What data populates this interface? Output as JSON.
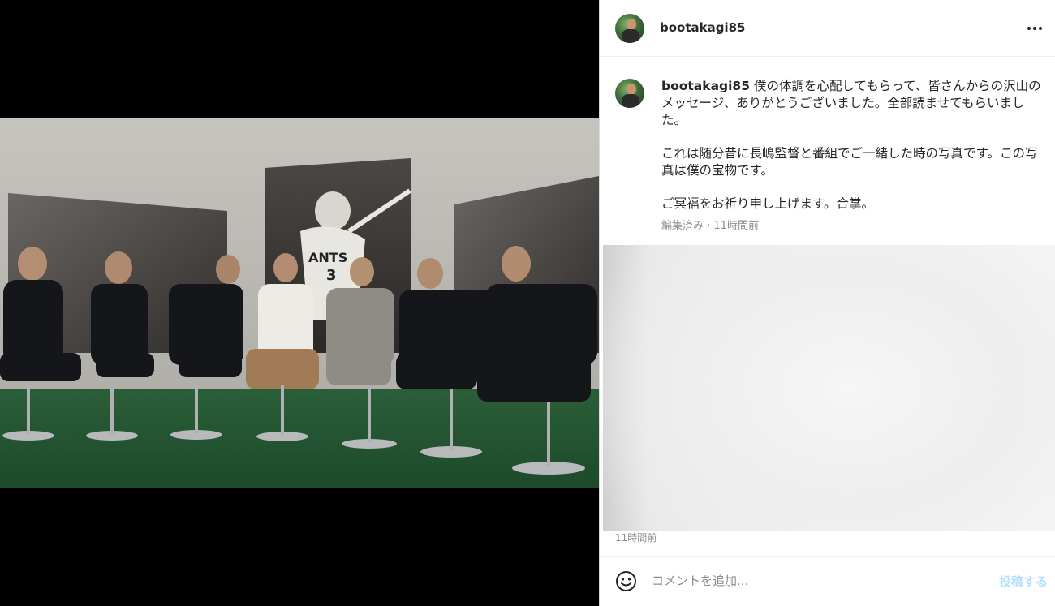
{
  "post": {
    "username": "bootakagi85",
    "caption_paragraph_1": "僕の体調を心配してもらって、皆さんからの沢山のメッセージ、ありがとうございました。全部読ませてもらいました。",
    "caption_paragraph_2": "これは随分昔に長嶋監督と番組でご一緒した時の写真です。この写真は僕の宝物です。",
    "caption_paragraph_3": "ご冥福をお祈り申し上げます。合掌。",
    "caption_meta": "編集済み · 11時間前",
    "timestamp": "11時間前"
  },
  "photo": {
    "jersey_text": "ANTS",
    "jersey_number": "3"
  },
  "comment_box": {
    "placeholder": "コメントを追加...",
    "post_label": "投稿する"
  },
  "icons": {
    "more": "more-options-icon",
    "emoji": "emoji-icon"
  },
  "colors": {
    "text": "#262626",
    "secondary_text": "#8e8e8e",
    "post_button_disabled": "#b2dffc"
  }
}
